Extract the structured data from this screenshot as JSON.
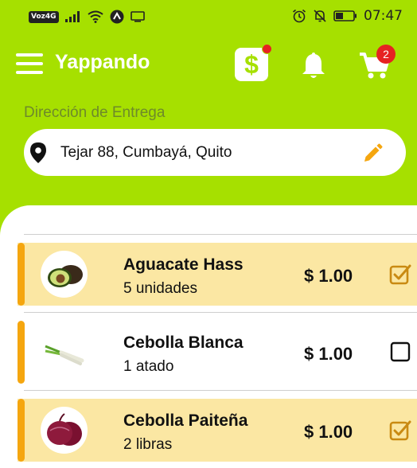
{
  "status_bar": {
    "volte": "Voz4G",
    "time": "07:47"
  },
  "header": {
    "title": "Yappando",
    "cart_count": "2",
    "wallet_symbol": "$"
  },
  "address": {
    "label": "Dirección de Entrega",
    "value": "Tejar 88, Cumbayá, Quito"
  },
  "colors": {
    "brand_green": "#a6e000",
    "accent_orange": "#f5a60f",
    "selected_row": "#fbe7a3",
    "badge_red": "#e62222"
  },
  "products": [
    {
      "name": "Aguacate Hass",
      "quantity": "5 unidades",
      "price": "$ 1.00",
      "checked": true,
      "icon": "avocado-icon"
    },
    {
      "name": "Cebolla Blanca",
      "quantity": "1 atado",
      "price": "$ 1.00",
      "checked": false,
      "icon": "spring-onion-icon"
    },
    {
      "name": "Cebolla Paiteña",
      "quantity": "2 libras",
      "price": "$ 1.00",
      "checked": true,
      "icon": "red-onion-icon"
    }
  ]
}
